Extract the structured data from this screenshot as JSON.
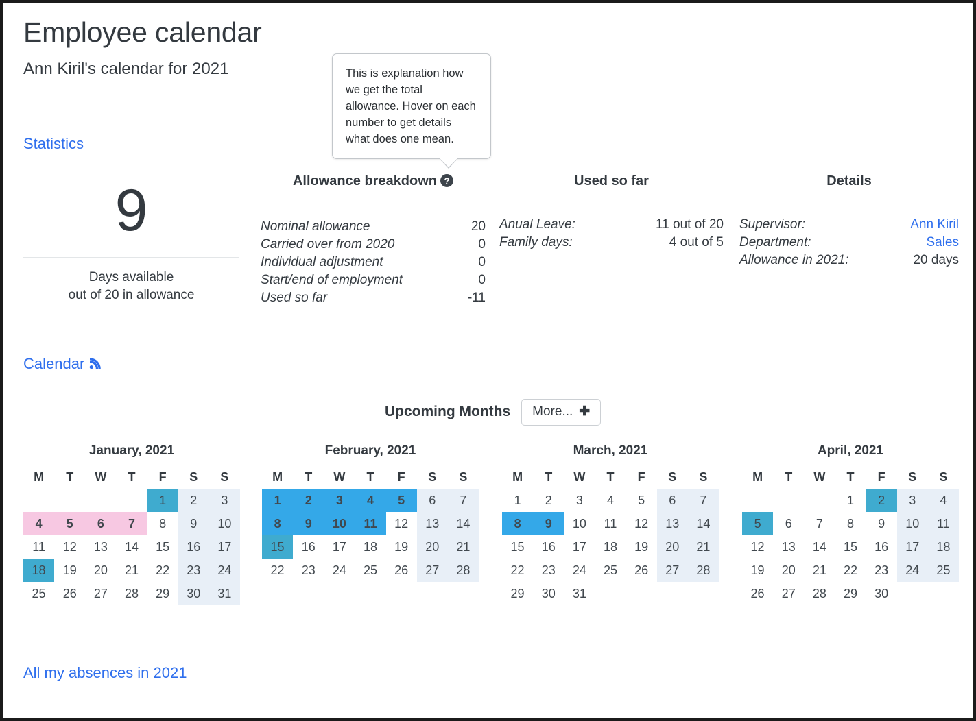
{
  "header": {
    "title": "Employee calendar",
    "subtitle": "Ann Kiril's calendar for 2021"
  },
  "sections": {
    "statistics_label": "Statistics",
    "calendar_label": "Calendar",
    "calendar_feed_icon": "rss-feed-icon",
    "absences_link": "All my absences in 2021"
  },
  "tooltip": {
    "text": "This is explanation how we get the total allowance. Hover on each number to get details what does one mean."
  },
  "available": {
    "number": "9",
    "caption_line1": "Days available",
    "caption_line2": "out of 20 in allowance"
  },
  "breakdown": {
    "title": "Allowance breakdown",
    "help_icon": "help-circle-icon",
    "rows": [
      {
        "label": "Nominal allowance",
        "value": "20"
      },
      {
        "label": "Carried over from 2020",
        "value": "0"
      },
      {
        "label": "Individual adjustment",
        "value": "0"
      },
      {
        "label": "Start/end of employment",
        "value": "0"
      },
      {
        "label": "Used so far",
        "value": "-11"
      }
    ]
  },
  "used_so_far": {
    "title": "Used so far",
    "rows": [
      {
        "label": "Anual Leave:",
        "value": "11 out of 20"
      },
      {
        "label": "Family days:",
        "value": "4 out of 5"
      }
    ]
  },
  "details": {
    "title": "Details",
    "rows": [
      {
        "label": "Supervisor:",
        "value": "Ann Kiril",
        "link": true
      },
      {
        "label": "Department:",
        "value": "Sales",
        "link": true
      },
      {
        "label": "Allowance in 2021:",
        "value": "20 days",
        "link": false
      }
    ]
  },
  "upcoming": {
    "title": "Upcoming Months",
    "more_label": "More...",
    "more_icon": "plus-icon"
  },
  "colors": {
    "link": "#2f6fed",
    "blue_highlight": "#34a8e8",
    "teal_highlight": "#3fabcf",
    "pink_highlight": "#f7c8e2",
    "weekend": "#e8eff7",
    "text": "#343a40"
  },
  "calendar": {
    "year": "2021",
    "weekday_headers": [
      "M",
      "T",
      "W",
      "T",
      "F",
      "S",
      "S"
    ],
    "months": [
      {
        "title": "January, 2021",
        "weeks": [
          [
            {
              "d": ""
            },
            {
              "d": ""
            },
            {
              "d": ""
            },
            {
              "d": ""
            },
            {
              "d": "1",
              "s": "teal"
            },
            {
              "d": "2",
              "s": "weekend"
            },
            {
              "d": "3",
              "s": "weekend"
            }
          ],
          [
            {
              "d": "4",
              "s": "pink"
            },
            {
              "d": "5",
              "s": "pink"
            },
            {
              "d": "6",
              "s": "pink"
            },
            {
              "d": "7",
              "s": "pink"
            },
            {
              "d": "8"
            },
            {
              "d": "9",
              "s": "weekend"
            },
            {
              "d": "10",
              "s": "weekend"
            }
          ],
          [
            {
              "d": "11"
            },
            {
              "d": "12"
            },
            {
              "d": "13"
            },
            {
              "d": "14"
            },
            {
              "d": "15"
            },
            {
              "d": "16",
              "s": "weekend"
            },
            {
              "d": "17",
              "s": "weekend"
            }
          ],
          [
            {
              "d": "18",
              "s": "teal"
            },
            {
              "d": "19"
            },
            {
              "d": "20"
            },
            {
              "d": "21"
            },
            {
              "d": "22"
            },
            {
              "d": "23",
              "s": "weekend"
            },
            {
              "d": "24",
              "s": "weekend"
            }
          ],
          [
            {
              "d": "25"
            },
            {
              "d": "26"
            },
            {
              "d": "27"
            },
            {
              "d": "28"
            },
            {
              "d": "29"
            },
            {
              "d": "30",
              "s": "weekend dim"
            },
            {
              "d": "31",
              "s": "weekend"
            }
          ]
        ]
      },
      {
        "title": "February, 2021",
        "weeks": [
          [
            {
              "d": "1",
              "s": "blue"
            },
            {
              "d": "2",
              "s": "blue"
            },
            {
              "d": "3",
              "s": "blue"
            },
            {
              "d": "4",
              "s": "blue"
            },
            {
              "d": "5",
              "s": "blue"
            },
            {
              "d": "6",
              "s": "weekend"
            },
            {
              "d": "7",
              "s": "weekend"
            }
          ],
          [
            {
              "d": "8",
              "s": "blue"
            },
            {
              "d": "9",
              "s": "blue"
            },
            {
              "d": "10",
              "s": "blue"
            },
            {
              "d": "11",
              "s": "blue"
            },
            {
              "d": "12"
            },
            {
              "d": "13",
              "s": "weekend"
            },
            {
              "d": "14",
              "s": "weekend"
            }
          ],
          [
            {
              "d": "15",
              "s": "teal"
            },
            {
              "d": "16"
            },
            {
              "d": "17"
            },
            {
              "d": "18"
            },
            {
              "d": "19"
            },
            {
              "d": "20",
              "s": "weekend"
            },
            {
              "d": "21",
              "s": "weekend"
            }
          ],
          [
            {
              "d": "22"
            },
            {
              "d": "23"
            },
            {
              "d": "24"
            },
            {
              "d": "25"
            },
            {
              "d": "26"
            },
            {
              "d": "27",
              "s": "weekend"
            },
            {
              "d": "28",
              "s": "weekend"
            }
          ]
        ]
      },
      {
        "title": "March, 2021",
        "weeks": [
          [
            {
              "d": "1"
            },
            {
              "d": "2"
            },
            {
              "d": "3"
            },
            {
              "d": "4"
            },
            {
              "d": "5"
            },
            {
              "d": "6",
              "s": "weekend"
            },
            {
              "d": "7",
              "s": "weekend"
            }
          ],
          [
            {
              "d": "8",
              "s": "blue"
            },
            {
              "d": "9",
              "s": "blue"
            },
            {
              "d": "10"
            },
            {
              "d": "11"
            },
            {
              "d": "12"
            },
            {
              "d": "13",
              "s": "weekend"
            },
            {
              "d": "14",
              "s": "weekend"
            }
          ],
          [
            {
              "d": "15"
            },
            {
              "d": "16"
            },
            {
              "d": "17"
            },
            {
              "d": "18"
            },
            {
              "d": "19"
            },
            {
              "d": "20",
              "s": "weekend"
            },
            {
              "d": "21",
              "s": "weekend"
            }
          ],
          [
            {
              "d": "22"
            },
            {
              "d": "23"
            },
            {
              "d": "24"
            },
            {
              "d": "25"
            },
            {
              "d": "26"
            },
            {
              "d": "27",
              "s": "weekend"
            },
            {
              "d": "28",
              "s": "weekend"
            }
          ],
          [
            {
              "d": "29"
            },
            {
              "d": "30"
            },
            {
              "d": "31"
            },
            {
              "d": ""
            },
            {
              "d": ""
            },
            {
              "d": ""
            },
            {
              "d": ""
            }
          ]
        ]
      },
      {
        "title": "April, 2021",
        "weeks": [
          [
            {
              "d": ""
            },
            {
              "d": ""
            },
            {
              "d": ""
            },
            {
              "d": "1"
            },
            {
              "d": "2",
              "s": "teal"
            },
            {
              "d": "3",
              "s": "weekend"
            },
            {
              "d": "4",
              "s": "weekend"
            }
          ],
          [
            {
              "d": "5",
              "s": "teal"
            },
            {
              "d": "6"
            },
            {
              "d": "7"
            },
            {
              "d": "8"
            },
            {
              "d": "9"
            },
            {
              "d": "10",
              "s": "weekend"
            },
            {
              "d": "11",
              "s": "weekend"
            }
          ],
          [
            {
              "d": "12"
            },
            {
              "d": "13"
            },
            {
              "d": "14"
            },
            {
              "d": "15"
            },
            {
              "d": "16"
            },
            {
              "d": "17",
              "s": "weekend"
            },
            {
              "d": "18",
              "s": "weekend"
            }
          ],
          [
            {
              "d": "19"
            },
            {
              "d": "20"
            },
            {
              "d": "21"
            },
            {
              "d": "22"
            },
            {
              "d": "23"
            },
            {
              "d": "24",
              "s": "weekend"
            },
            {
              "d": "25",
              "s": "weekend"
            }
          ],
          [
            {
              "d": "26"
            },
            {
              "d": "27"
            },
            {
              "d": "28"
            },
            {
              "d": "29"
            },
            {
              "d": "30"
            },
            {
              "d": ""
            },
            {
              "d": ""
            }
          ]
        ]
      }
    ]
  }
}
